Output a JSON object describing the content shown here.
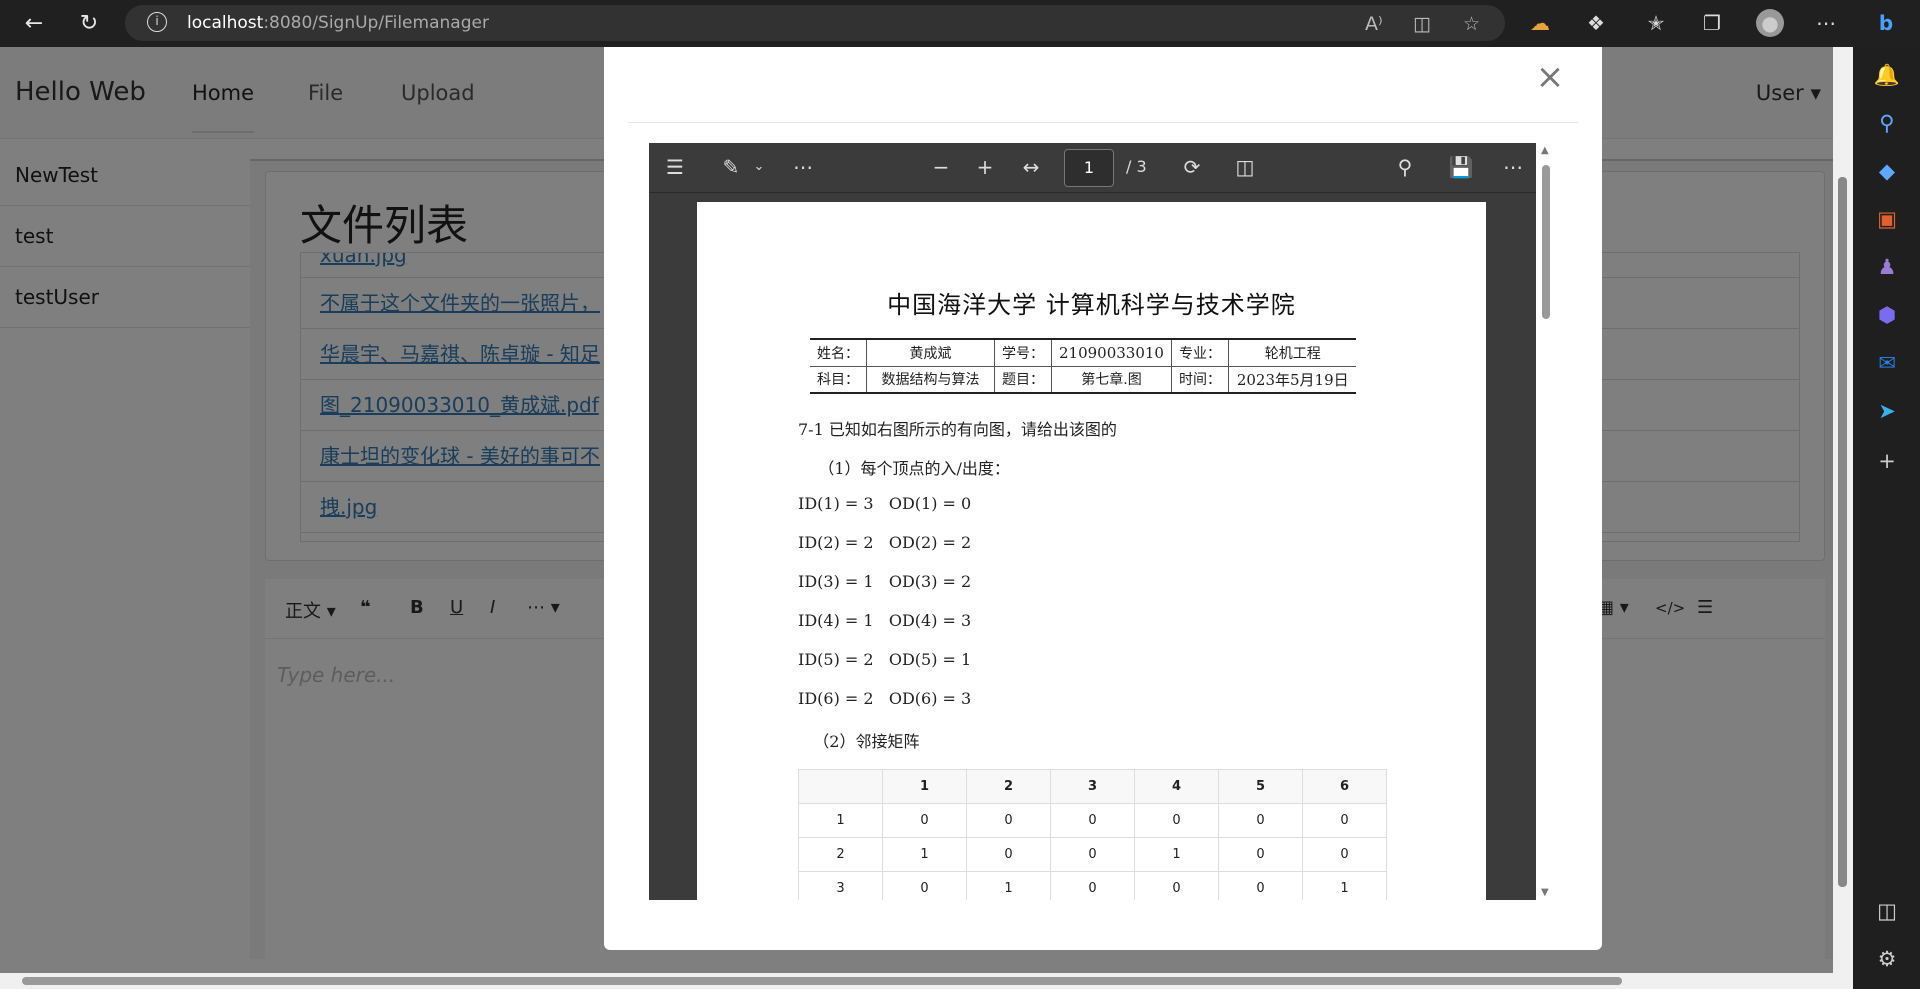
{
  "browser": {
    "url_host": "localhost",
    "url_path": ":8080/SignUp/Filemanager",
    "read_aloud_icon": "A⁾",
    "icons": [
      "back-icon",
      "refresh-icon",
      "info-icon",
      "read-aloud-icon",
      "split-screen-icon",
      "favorite-icon",
      "extension-icon",
      "extensions-icon",
      "favorites-icon",
      "collections-icon",
      "profile-icon",
      "more-icon",
      "bing-icon"
    ]
  },
  "navbar": {
    "brand": "Hello Web",
    "links": [
      "Home",
      "File",
      "Upload"
    ],
    "user": "User"
  },
  "sidebar": {
    "items": [
      "NewTest",
      "test",
      "testUser"
    ]
  },
  "file_list": {
    "title": "文件列表",
    "items": [
      "xuan.jpg",
      "不属于这个文件夹的一张照片，",
      "华晨宇、马嘉祺、陈卓璇 - 知足",
      "图_21090033010_黄成斌.pdf",
      "康士坦的变化球 - 美好的事可不",
      "拽.jpg"
    ]
  },
  "editor": {
    "style_label": "正文",
    "placeholder": "Type here..."
  },
  "pdf": {
    "page_current": "1",
    "page_total": "/ 3",
    "title": "中国海洋大学 计算机科学与技术学院",
    "info_rows": [
      [
        "姓名：",
        "黄成斌",
        "学号：",
        "21090033010",
        "专业：",
        "轮机工程"
      ],
      [
        "科目：",
        "数据结构与算法",
        "题目：",
        "第七章.图",
        "时间：",
        "2023年5月19日"
      ]
    ],
    "lines": [
      "7-1 已知如右图所示的有向图，请给出该图的",
      "    （1）每个顶点的入/出度：",
      "ID(1) = 3   OD(1) = 0",
      "ID(2) = 2   OD(2) = 2",
      "ID(3) = 1   OD(3) = 2",
      "ID(4) = 1   OD(4) = 3",
      "ID(5) = 2   OD(5) = 1",
      "ID(6) = 2   OD(6) = 3",
      "   （2）邻接矩阵"
    ],
    "matrix_header": [
      "",
      "1",
      "2",
      "3",
      "4",
      "5",
      "6"
    ],
    "matrix_rows": [
      [
        "1",
        "0",
        "0",
        "0",
        "0",
        "0",
        "0"
      ],
      [
        "2",
        "1",
        "0",
        "0",
        "1",
        "0",
        "0"
      ],
      [
        "3",
        "0",
        "1",
        "0",
        "0",
        "0",
        "1"
      ]
    ]
  },
  "modal": {
    "close_symbol": "×"
  }
}
